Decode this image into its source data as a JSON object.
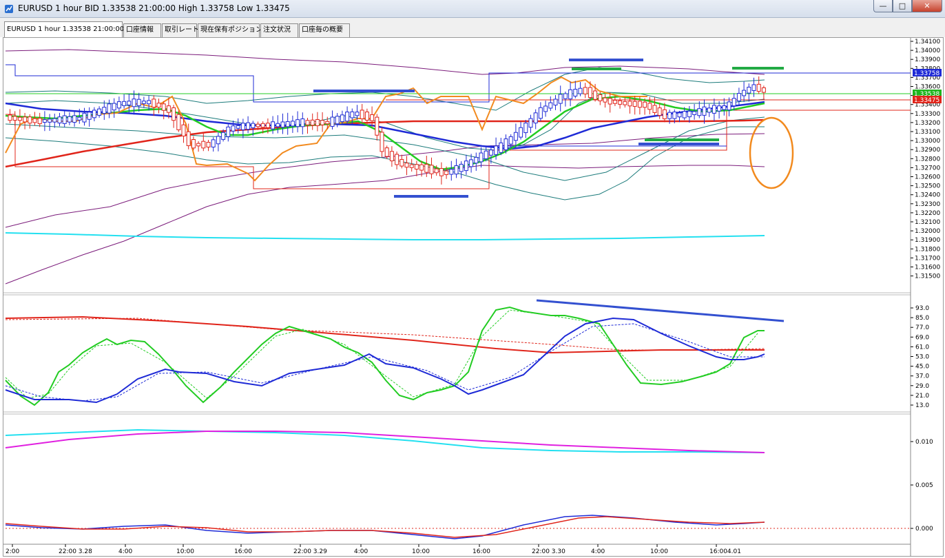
{
  "window": {
    "title": "EURUSD 1 hour BID 1.33538 21:00:00 High 1.33758 Low 1.33475",
    "icon": "chart-app-icon",
    "buttons": [
      "minimize-icon",
      "maximize-icon",
      "close-icon"
    ]
  },
  "tabs": [
    {
      "label": "EURUSD 1 hour 1.33538 21:00:00",
      "active": true
    },
    {
      "label": "口座情報",
      "active": false
    },
    {
      "label": "取引レート",
      "active": false
    },
    {
      "label": "現在保有ポジション",
      "active": false
    },
    {
      "label": "注文状況",
      "active": false
    },
    {
      "label": "口座毎の概要",
      "active": false
    }
  ],
  "price_axis": {
    "ticks": [
      "1.34100",
      "1.34000",
      "1.33900",
      "1.33800",
      "1.33700",
      "1.33600",
      "1.33500",
      "1.33400",
      "1.33300",
      "1.33200",
      "1.33100",
      "1.33000",
      "1.32900",
      "1.32800",
      "1.32700",
      "1.32600",
      "1.32500",
      "1.32400",
      "1.32300",
      "1.32200",
      "1.32100",
      "1.32000",
      "1.31900",
      "1.31800",
      "1.31700",
      "1.31600",
      "1.31500"
    ],
    "tags": [
      {
        "text": "1.33758",
        "color": "#1e2ad6"
      },
      {
        "text": "1.33538",
        "color": "#1db51d"
      },
      {
        "text": "1.33475",
        "color": "#e0241a"
      }
    ]
  },
  "oscillator_axis": {
    "ticks": [
      "93.0",
      "85.0",
      "77.0",
      "69.0",
      "61.0",
      "53.0",
      "45.0",
      "37.0",
      "29.0",
      "21.0",
      "13.0"
    ]
  },
  "lower_axis": {
    "ticks": [
      "0.010",
      "0.005",
      "0.000"
    ]
  },
  "time_axis": {
    "labels": [
      "2:00",
      "22:00 3.28",
      "4:00",
      "10:00",
      "16:00",
      "22:00 3.29",
      "4:00",
      "10:00",
      "16:00",
      "22:00 3.30",
      "4:00",
      "10:00",
      "16:004.01"
    ]
  },
  "colors": {
    "bull_candle": "#1e2ad6",
    "bear_candle": "#e0241a",
    "ma_fast": "#22cc22",
    "ma_mid": "#1e2ad6",
    "ma_slow": "#e0241a",
    "ma_orange": "#f28a1e",
    "band_purple": "#7a1a7a",
    "band_teal": "#1a7a7a",
    "cyan": "#22e0f0",
    "magenta": "#e020e0",
    "annotation_blue": "#3350d0",
    "annotation_green": "#22aa44",
    "annotation_orange": "#f28a1e"
  }
}
